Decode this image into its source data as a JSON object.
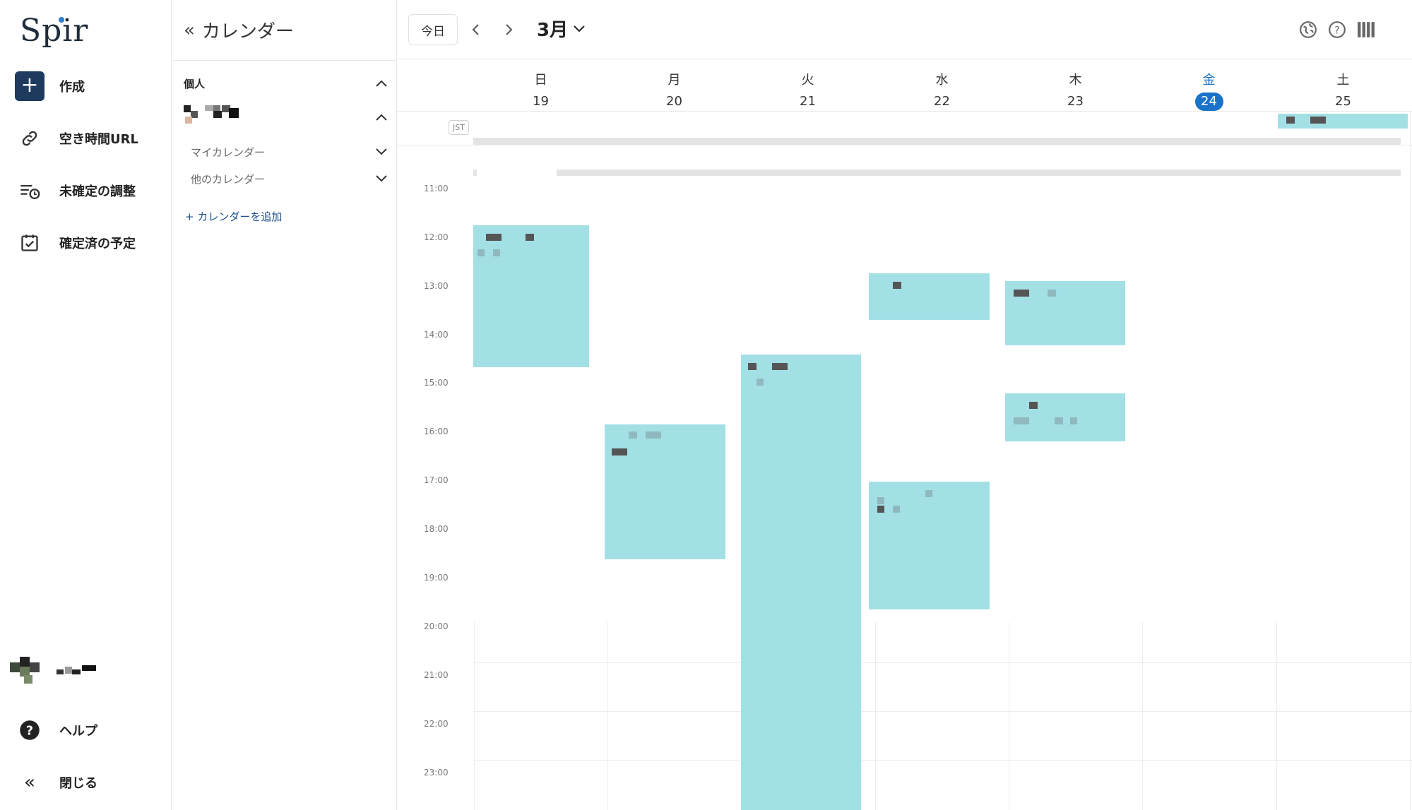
{
  "app": {
    "logo": "Spir"
  },
  "nav": {
    "create": "作成",
    "free_url": "空き時間URL",
    "unconfirmed": "未確定の調整",
    "confirmed": "確定済の予定",
    "help": "ヘルプ",
    "close": "閉じる"
  },
  "calendar_panel": {
    "title": "カレンダー",
    "section_personal": "個人",
    "my_calendars": "マイカレンダー",
    "other_calendars": "他のカレンダー",
    "add_calendar": "+ カレンダーを追加"
  },
  "toolbar": {
    "today": "今日",
    "month": "3月"
  },
  "timezone": "JST",
  "days": [
    {
      "dow": "日",
      "num": "19"
    },
    {
      "dow": "月",
      "num": "20"
    },
    {
      "dow": "火",
      "num": "21"
    },
    {
      "dow": "水",
      "num": "22"
    },
    {
      "dow": "木",
      "num": "23"
    },
    {
      "dow": "金",
      "num": "24",
      "today": true
    },
    {
      "dow": "土",
      "num": "25"
    }
  ],
  "hours": [
    "11:00",
    "12:00",
    "13:00",
    "14:00",
    "15:00",
    "16:00",
    "17:00",
    "18:00",
    "19:00",
    "20:00",
    "21:00",
    "22:00",
    "23:00"
  ],
  "colors": {
    "event": "#a2e0e6",
    "today": "#1a73c8",
    "nav_create": "#1e3a5f"
  }
}
